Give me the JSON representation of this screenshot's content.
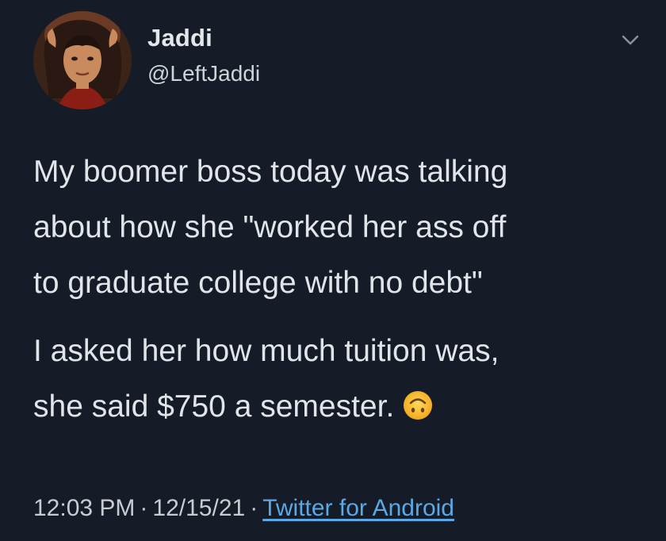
{
  "author": {
    "display_name": "Jaddi",
    "handle": "@LeftJaddi",
    "avatar_icon": "avatar-illustration"
  },
  "tweet": {
    "paragraph_1": "My boomer boss today was talking\nabout how she \"worked her ass off\nto graduate college with no debt\"",
    "paragraph_2": "I asked her how much tuition was,\nshe said $750 a semester.",
    "emoji": "upside-down-face-icon"
  },
  "meta": {
    "time": "12:03 PM",
    "separator": "·",
    "date": "12/15/21",
    "source": "Twitter for Android"
  },
  "menu_icon": "chevron-down-icon",
  "colors": {
    "background": "#151c27",
    "text": "#e1e4e8",
    "link": "#5aa8e6"
  }
}
